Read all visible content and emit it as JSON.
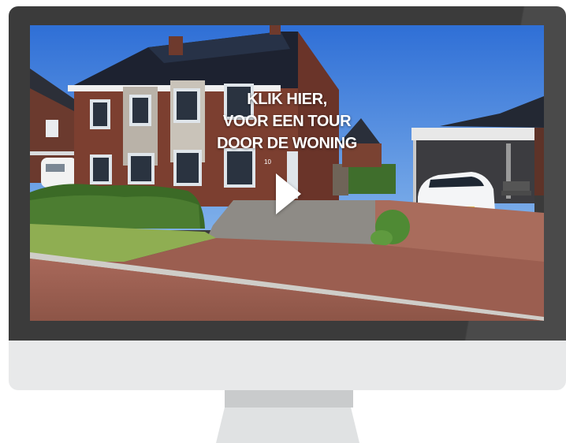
{
  "video": {
    "cta_line1": "KLIK HIER,",
    "cta_line2": "VOOR EEN TOUR",
    "cta_line3": "DOOR DE WONING",
    "house_number": "10"
  },
  "icons": {
    "play": "play-icon"
  },
  "colors": {
    "monitor_frame": "#3b3b3b",
    "monitor_chin": "#e8e9ea",
    "stand": "#c9cbcc",
    "overlay_text": "#ffffff"
  }
}
